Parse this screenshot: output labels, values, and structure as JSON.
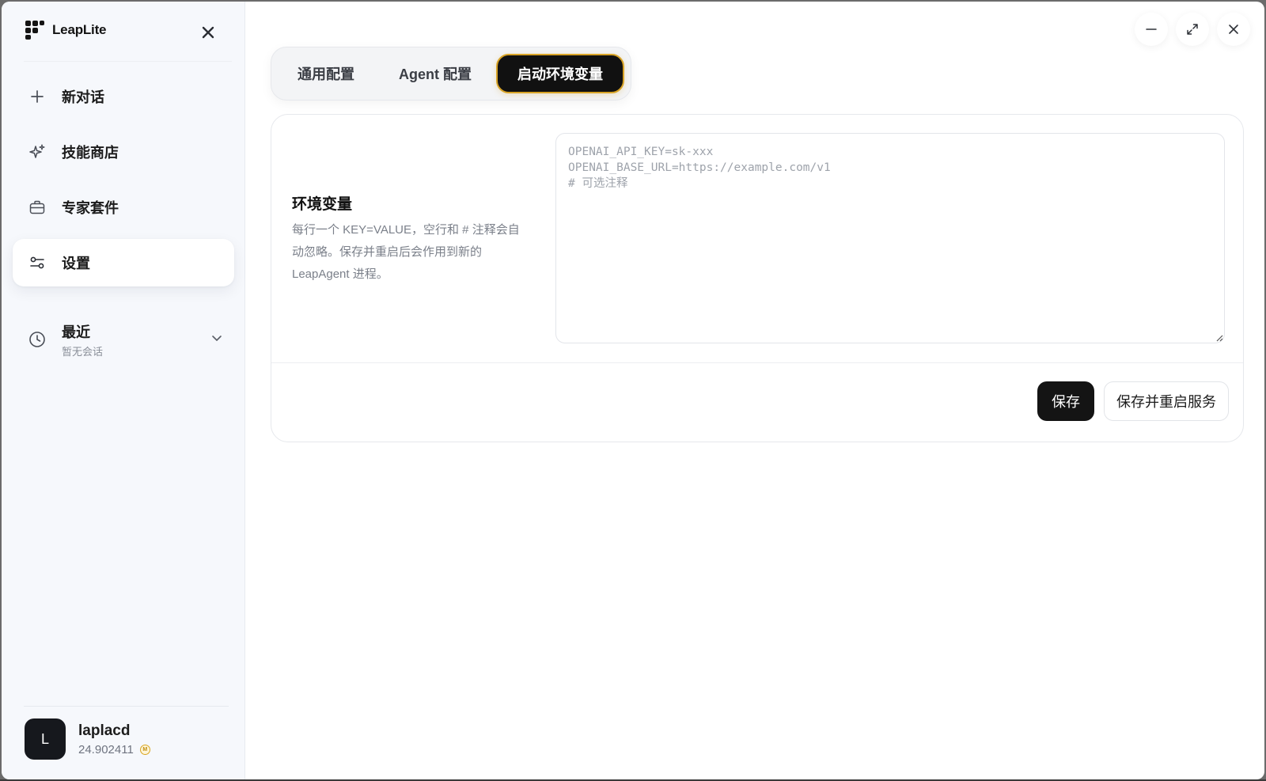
{
  "app": {
    "name": "LeapLite"
  },
  "sidebar": {
    "items": [
      {
        "label": "新对话",
        "icon": "plus-icon"
      },
      {
        "label": "技能商店",
        "icon": "sparkle-icon"
      },
      {
        "label": "专家套件",
        "icon": "briefcase-icon"
      },
      {
        "label": "设置",
        "icon": "sliders-icon",
        "active": true
      }
    ],
    "recent": {
      "title": "最近",
      "subtitle": "暂无会话"
    }
  },
  "user": {
    "avatar_letter": "L",
    "name": "laplacd",
    "balance": "24.902411",
    "coin_icon": "coin-icon"
  },
  "tabs": [
    {
      "label": "通用配置"
    },
    {
      "label": "Agent 配置"
    },
    {
      "label": "启动环境变量",
      "active": true
    }
  ],
  "env_section": {
    "title": "环境变量",
    "description": "每行一个 KEY=VALUE，空行和 # 注释会自动忽略。保存并重启后会作用到新的 LeapAgent 进程。",
    "placeholder": "OPENAI_API_KEY=sk-xxx\nOPENAI_BASE_URL=https://example.com/v1\n# 可选注释",
    "value": ""
  },
  "actions": {
    "save_label": "保存",
    "save_restart_label": "保存并重启服务"
  },
  "colors": {
    "accent_border": "#d8a326",
    "primary_button": "#141414",
    "sidebar_bg": "#f6f8fc"
  }
}
